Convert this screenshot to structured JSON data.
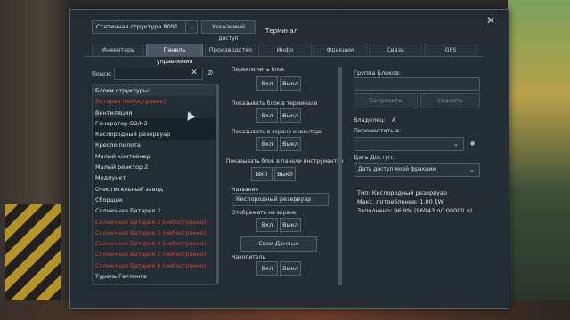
{
  "window": {
    "title": "Терминал",
    "close_icon": "close-icon"
  },
  "top": {
    "grid_select": "Статичная структура 8091",
    "share_button": "Уважаемый доступ"
  },
  "tabs": [
    {
      "label": "Инвентарь",
      "active": false
    },
    {
      "label": "Панель управления",
      "active": true
    },
    {
      "label": "Производство",
      "active": false
    },
    {
      "label": "Инфо",
      "active": false
    },
    {
      "label": "Фракции",
      "active": false
    },
    {
      "label": "Связь",
      "active": false
    },
    {
      "label": "GPS",
      "active": false
    }
  ],
  "search": {
    "label": "Поиск:",
    "value": "",
    "clear_icon": "close-icon",
    "toggle_icon": "eye-slash-icon"
  },
  "block_list": [
    {
      "label": "Блоки структуры:",
      "type": "header"
    },
    {
      "label": "Батарея (небостроено)",
      "type": "red"
    },
    {
      "label": "Вентиляция",
      "type": "normal"
    },
    {
      "label": "Генератор O2/H2",
      "type": "selected"
    },
    {
      "label": "Кислородный резервуар",
      "type": "selected"
    },
    {
      "label": "Кресло пилота",
      "type": "normal"
    },
    {
      "label": "Малый контейнер",
      "type": "normal"
    },
    {
      "label": "Малый реактор 2",
      "type": "normal"
    },
    {
      "label": "Медпункт",
      "type": "normal"
    },
    {
      "label": "Очистительный завод",
      "type": "normal"
    },
    {
      "label": "Сборщик",
      "type": "normal"
    },
    {
      "label": "Солнечная Батарея 2",
      "type": "normal"
    },
    {
      "label": "Солнечная Батарея 2 (небостроено)",
      "type": "red"
    },
    {
      "label": "Солнечная Батарея 3 (небостроено)",
      "type": "red"
    },
    {
      "label": "Солнечная Батарея 4 (небостроено)",
      "type": "red"
    },
    {
      "label": "Солнечная Батарея 5 (небостроено)",
      "type": "red"
    },
    {
      "label": "Солнечная Батарея 6 (небостроено)",
      "type": "red"
    },
    {
      "label": "Турель Гатлинга",
      "type": "normal"
    }
  ],
  "controls": {
    "toggle_block": "Переключить блок",
    "show_in_terminal": "Показывать блок в терминале",
    "show_on_inventory": "Показывать в экране инвентаря",
    "show_in_toolbar": "Показывать блок в панели инструментов",
    "name_label": "Название",
    "name_value": "Кислородный резервуар",
    "show_on_hud": "Отображать на экране",
    "custom_data": "Свои Данные",
    "stockpile": "Накопитель",
    "on": "Вкл",
    "off": "Выкл"
  },
  "right": {
    "group_label": "Группа Блоков:",
    "group_value": "",
    "save_button": "Сохранить",
    "delete_button": "Удалить",
    "owner_label": "Владелец:",
    "owner_value": "A",
    "transfer_label": "Переместить в:",
    "transfer_value": "",
    "share_label": "Дать Доступ:",
    "share_value": "Дать доступ моей фракции",
    "info": [
      "Тип: Кислородный резервуар",
      "Макс. потребление: 1.00 kW",
      "Заполнено: 96.9% (96943 л/100000 л)"
    ]
  }
}
